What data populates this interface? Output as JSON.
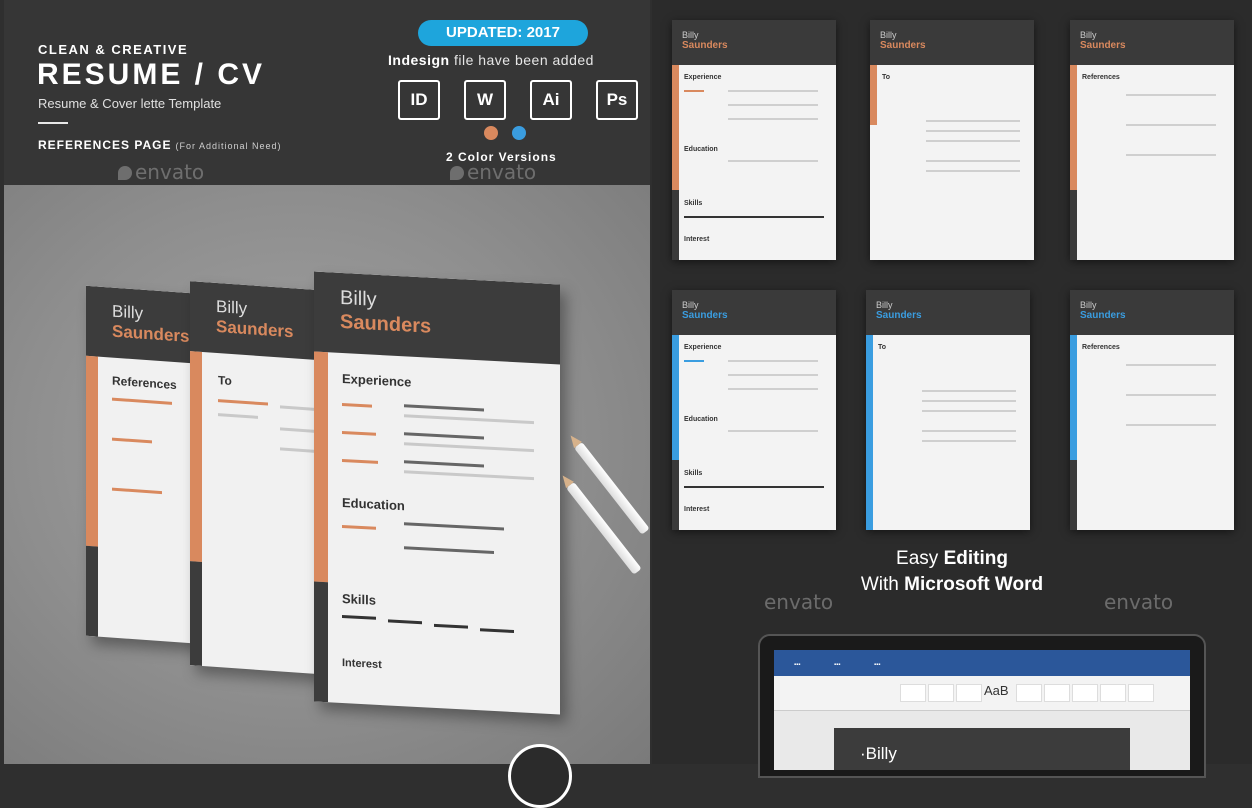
{
  "header": {
    "kicker": "CLEAN & CREATIVE",
    "title": "RESUME / CV",
    "subtitle": "Resume  & Cover lette Template",
    "references": "REFERENCES PAGE",
    "references_note": "(For Additional Need)",
    "watermark": "envato"
  },
  "badge": {
    "updated": "UPDATED: 2017"
  },
  "indesign": {
    "bold": "Indesign",
    "rest": " file have been added"
  },
  "software_icons": [
    "ID",
    "W",
    "Ai",
    "Ps"
  ],
  "colors": {
    "orange": "#d9895e",
    "blue": "#3a9de0",
    "dark": "#3a3a3a"
  },
  "color_versions": "2 Color Versions",
  "resume": {
    "first_name": "Billy",
    "last_name": "Saunders",
    "sections": {
      "references": "References",
      "to": "To",
      "experience": "Experience",
      "education": "Education",
      "skills": "Skills",
      "interest": "Interest"
    }
  },
  "right_panel": {
    "easy_line1_pre": "Easy ",
    "easy_line1_bold": "Editing",
    "easy_line2_pre": "With ",
    "easy_line2_bold": "Microsoft Word",
    "word_doc_name": "·Billy",
    "word_style_sample": "AaB"
  }
}
